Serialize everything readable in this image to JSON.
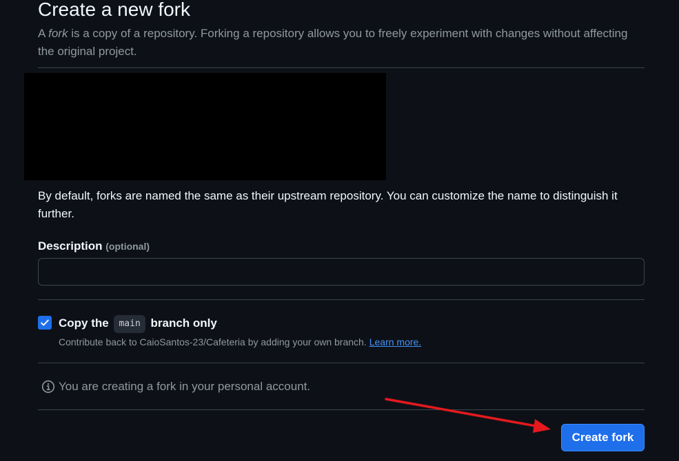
{
  "header": {
    "title": "Create a new fork",
    "subtitle_emphasis": "fork",
    "subtitle_prefix": "A ",
    "subtitle_rest": " is a copy of a repository. Forking a repository allows you to freely experiment with changes without affecting the original project."
  },
  "naming_note": "By default, forks are named the same as their upstream repository. You can customize the name to distinguish it further.",
  "description": {
    "label": "Description",
    "optional_label": "(optional)",
    "value": "",
    "placeholder": ""
  },
  "copy_branch": {
    "checked": true,
    "label_prefix": "Copy the",
    "branch": "main",
    "label_suffix": "branch only",
    "help_text": "Contribute back to CaioSantos-23/Cafeteria by adding your own branch.",
    "learn_more": "Learn more."
  },
  "info": {
    "icon": "info-icon",
    "text": "You are creating a fork in your personal account."
  },
  "actions": {
    "create_label": "Create fork"
  },
  "colors": {
    "background": "#0d1117",
    "primary_button": "#1f6feb",
    "link": "#4493f8",
    "annotation_arrow": "#e5191e"
  }
}
